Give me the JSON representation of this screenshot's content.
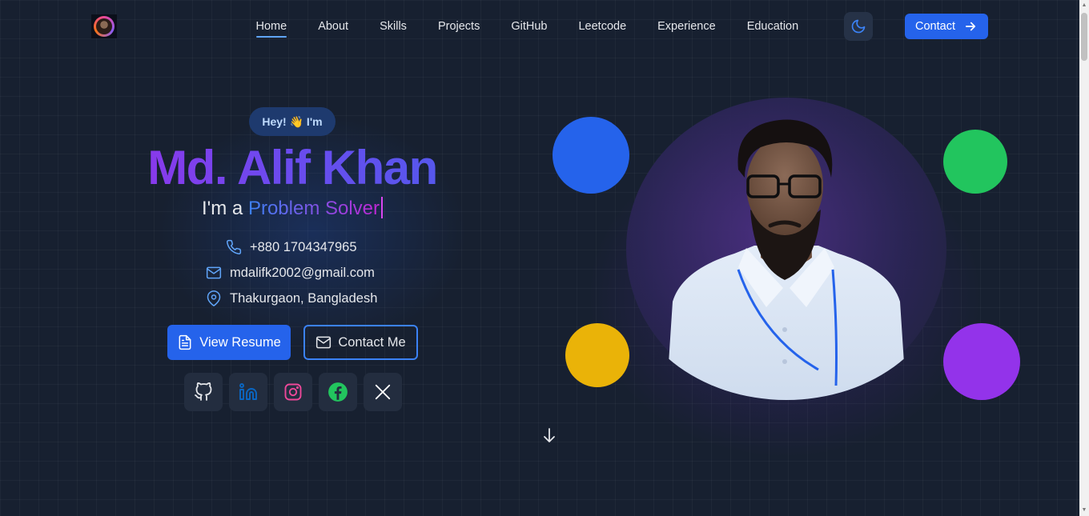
{
  "nav": {
    "links": [
      {
        "label": "Home",
        "active": true
      },
      {
        "label": "About",
        "active": false
      },
      {
        "label": "Skills",
        "active": false
      },
      {
        "label": "Projects",
        "active": false
      },
      {
        "label": "GitHub",
        "active": false
      },
      {
        "label": "Leetcode",
        "active": false
      },
      {
        "label": "Experience",
        "active": false
      },
      {
        "label": "Education",
        "active": false
      }
    ],
    "theme_icon": "moon-icon",
    "contact_label": "Contact"
  },
  "hero": {
    "greeting": "Hey! 👋 I'm",
    "name": "Md. Alif Khan",
    "role_prefix": "I'm a ",
    "role_word": "Problem Solver",
    "phone": "+880 1704347965",
    "email": "mdalifk2002@gmail.com",
    "location": "Thakurgaon, Bangladesh",
    "resume_label": "View Resume",
    "contact_me_label": "Contact Me",
    "socials": [
      {
        "name": "github",
        "icon": "github-icon",
        "color": "#e5e7eb"
      },
      {
        "name": "linkedin",
        "icon": "linkedin-icon",
        "color": "#0a66c2"
      },
      {
        "name": "instagram",
        "icon": "instagram-icon",
        "color": "#ec4899"
      },
      {
        "name": "facebook",
        "icon": "facebook-icon",
        "color": "#22c55e"
      },
      {
        "name": "x",
        "icon": "x-icon",
        "color": "#ffffff"
      }
    ]
  },
  "colors": {
    "accent": "#2563eb",
    "dot_blue": "#2563eb",
    "dot_green": "#22c55e",
    "dot_yellow": "#eab308",
    "dot_purple": "#9333ea"
  }
}
